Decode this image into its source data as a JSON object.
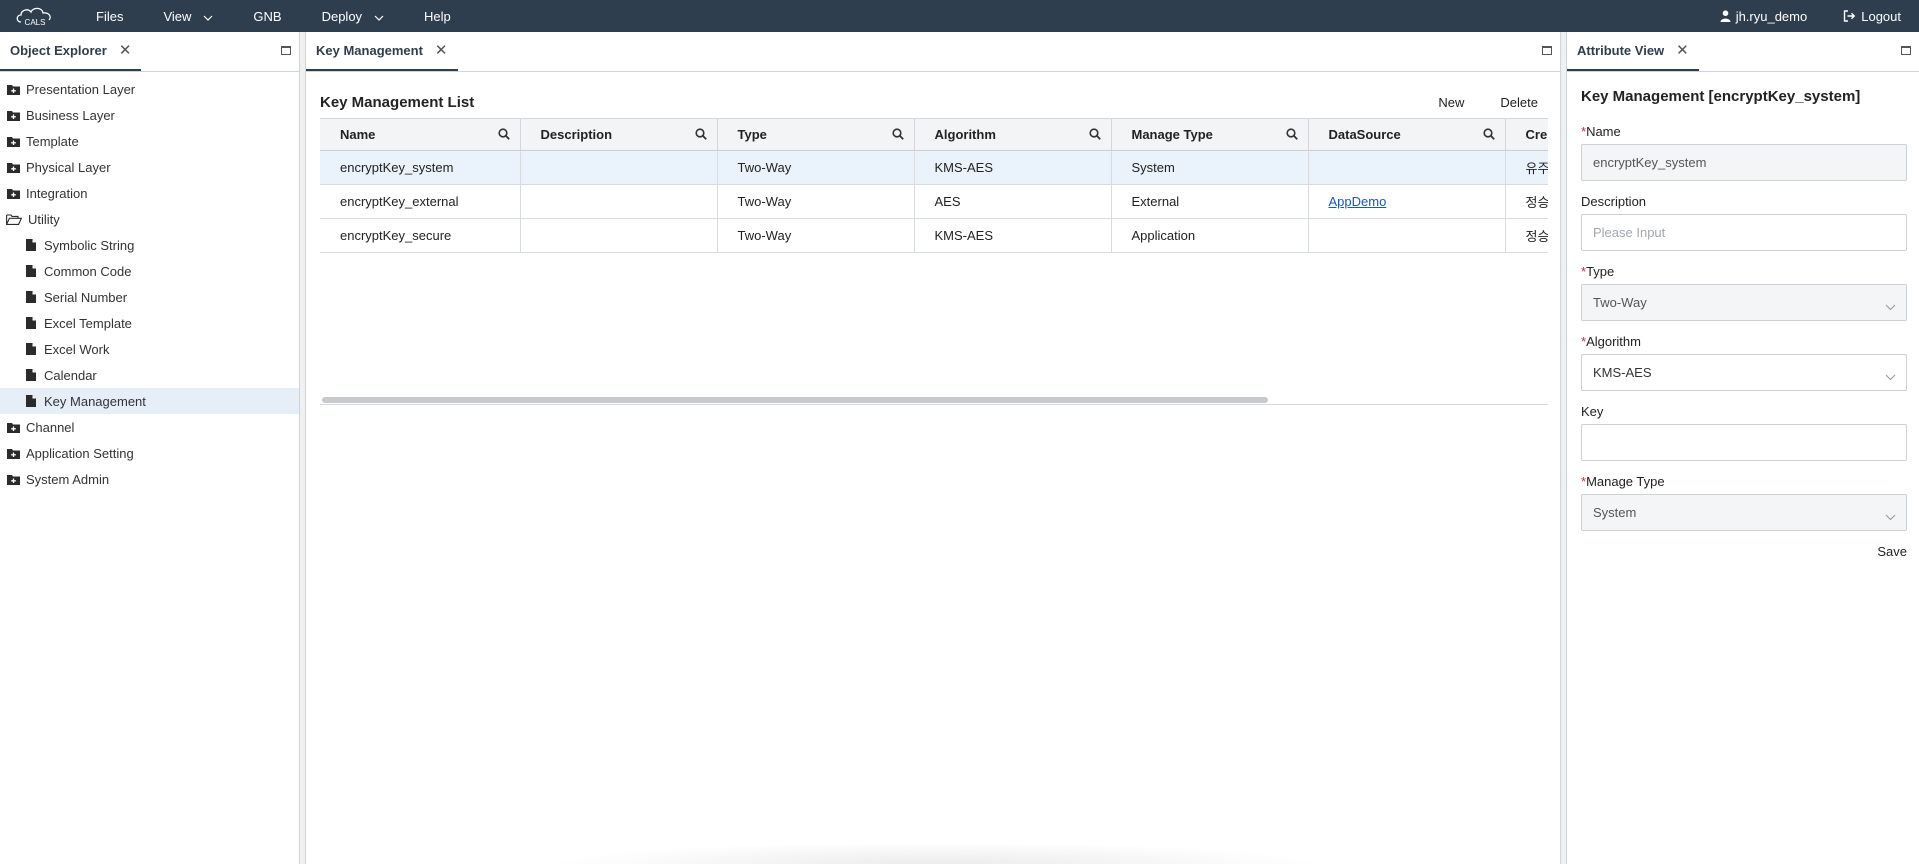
{
  "topbar": {
    "logo_text": "CALS",
    "menu": [
      {
        "label": "Files"
      },
      {
        "label": "View"
      },
      {
        "label": "GNB"
      },
      {
        "label": "Deploy"
      },
      {
        "label": "Help"
      }
    ],
    "user": "jh.ryu_demo",
    "logout": "Logout"
  },
  "explorer": {
    "tab_label": "Object Explorer",
    "items": [
      {
        "label": "Presentation Layer"
      },
      {
        "label": "Business Layer"
      },
      {
        "label": "Template"
      },
      {
        "label": "Physical Layer"
      },
      {
        "label": "Integration"
      },
      {
        "label": "Utility"
      },
      {
        "label": "Symbolic String"
      },
      {
        "label": "Common Code"
      },
      {
        "label": "Serial Number"
      },
      {
        "label": "Excel Template"
      },
      {
        "label": "Excel Work"
      },
      {
        "label": "Calendar"
      },
      {
        "label": "Key Management"
      },
      {
        "label": "Channel"
      },
      {
        "label": "Application Setting"
      },
      {
        "label": "System Admin"
      }
    ]
  },
  "center": {
    "tab_label": "Key Management",
    "list_title": "Key Management List",
    "new_label": "New",
    "delete_label": "Delete",
    "columns": [
      "Name",
      "Description",
      "Type",
      "Algorithm",
      "Manage Type",
      "DataSource",
      "Cre"
    ],
    "rows": [
      {
        "name": "encryptKey_system",
        "description": "",
        "type": "Two-Way",
        "algorithm": "KMS-AES",
        "manage_type": "System",
        "datasource": "",
        "creator": "유주"
      },
      {
        "name": "encryptKey_external",
        "description": "",
        "type": "Two-Way",
        "algorithm": "AES",
        "manage_type": "External",
        "datasource": "AppDemo",
        "creator": "정승"
      },
      {
        "name": "encryptKey_secure",
        "description": "",
        "type": "Two-Way",
        "algorithm": "KMS-AES",
        "manage_type": "Application",
        "datasource": "",
        "creator": "정승"
      }
    ]
  },
  "attribute": {
    "tab_label": "Attribute View",
    "title": "Key Management [encryptKey_system]",
    "required_mark": "*",
    "name_label": "Name",
    "name_value": "encryptKey_system",
    "description_label": "Description",
    "description_placeholder": "Please Input",
    "type_label": "Type",
    "type_value": "Two-Way",
    "algorithm_label": "Algorithm",
    "algorithm_value": "KMS-AES",
    "key_label": "Key",
    "key_value": "",
    "manage_type_label": "Manage Type",
    "manage_type_value": "System",
    "save_label": "Save"
  },
  "colors": {
    "topbar": "#2f3e4e",
    "selected_row": "#eaf3fb",
    "link": "#1a55c9",
    "required": "#d9262c"
  }
}
